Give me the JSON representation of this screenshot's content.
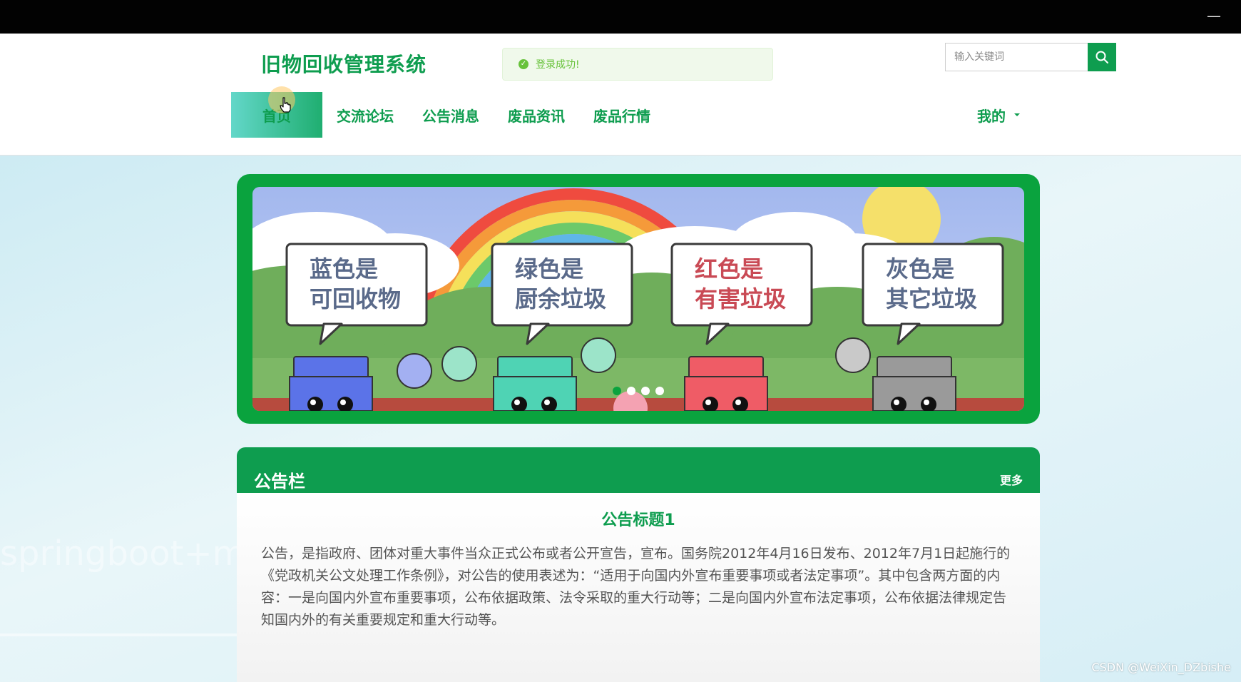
{
  "window": {
    "minimize_glyph": "—"
  },
  "header": {
    "site_title": "旧物回收管理系统",
    "toast": {
      "icon": "check-circle-icon",
      "message": "登录成功!"
    },
    "search": {
      "placeholder": "输入关键词",
      "icon": "search-icon"
    },
    "nav": [
      {
        "label": "首页",
        "active": true
      },
      {
        "label": "交流论坛",
        "active": false
      },
      {
        "label": "公告消息",
        "active": false
      },
      {
        "label": "废品资讯",
        "active": false
      },
      {
        "label": "废品行情",
        "active": false
      }
    ],
    "user_menu": {
      "label": "我的",
      "icon": "caret-down-icon"
    }
  },
  "banner": {
    "signs": [
      {
        "line1": "蓝色是",
        "line2": "可回收物",
        "color": "#5b73e8"
      },
      {
        "line1": "绿色是",
        "line2": "厨余垃圾",
        "color": "#4fd3b4"
      },
      {
        "line1": "红色是",
        "line2": "有害垃圾",
        "color": "#ef5c66"
      },
      {
        "line1": "灰色是",
        "line2": "其它垃圾",
        "color": "#9a9a9a"
      }
    ],
    "dots_total": 4,
    "dots_active": 1
  },
  "notice": {
    "heading": "公告栏",
    "more": "更多",
    "item_title": "公告标题1",
    "item_text": "公告，是指政府、团体对重大事件当众正式公布或者公开宣告，宣布。国务院2012年4月16日发布、2012年7月1日起施行的《党政机关公文处理工作条例》，对公告的使用表述为：“适用于向国内外宣布重要事项或者法定事项”。其中包含两方面的内容：一是向国内外宣布重要事项，公布依据政策、法令采取的重大行动等；二是向国内外宣布法定事项，公布依据法律规定告知国内外的有关重要规定和重大行动等。"
  },
  "background": {
    "watermark": "springboot+my"
  },
  "watermark_csdn": "CSDN @WeiXin_DZbishe",
  "colors": {
    "brand_green": "#0e9d4f",
    "banner_green": "#0aa33e",
    "toast_green": "#67c23a"
  }
}
